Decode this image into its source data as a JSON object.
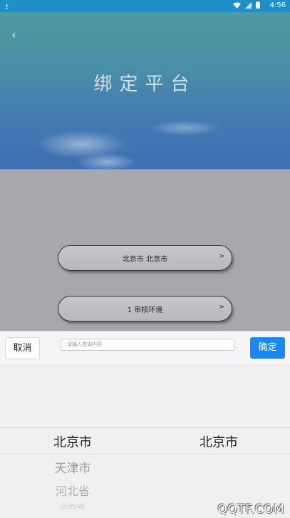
{
  "status_bar": {
    "download_icon": "download-icon",
    "wifi_icon": "wifi-icon",
    "signal_icon": "signal-icon",
    "battery_icon": "battery-icon",
    "time": "4:56"
  },
  "header": {
    "back_icon": "chevron-left-icon",
    "back_glyph": "‹",
    "title": "绑定平台"
  },
  "fields": {
    "region": {
      "label": "北京市 北京市",
      "arrow": ">"
    },
    "environment": {
      "label": "1 审核环境",
      "arrow": ">"
    }
  },
  "picker": {
    "cancel_label": "取消",
    "search_placeholder": "请输入查询内容",
    "confirm_label": "确定",
    "left_column": [
      "北京市",
      "天津市",
      "河北省",
      "山西省"
    ],
    "right_column": [
      "北京市"
    ]
  },
  "watermark": "QQTF.COM"
}
